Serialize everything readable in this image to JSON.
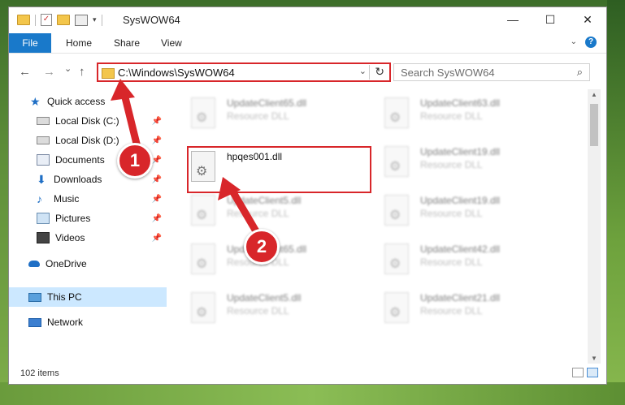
{
  "window": {
    "title": "SysWOW64",
    "controls": {
      "minimize": "—",
      "maximize": "☐",
      "close": "✕"
    }
  },
  "ribbon": {
    "file_tab": "File",
    "tabs": [
      "Home",
      "Share",
      "View"
    ]
  },
  "navigation": {
    "back_icon": "←",
    "forward_icon": "→",
    "recent_icon": "⌄",
    "up_icon": "↑",
    "address": "C:\\Windows\\SysWOW64",
    "refresh_icon": "↻",
    "search_placeholder": "Search SysWOW64",
    "search_icon": "⌕"
  },
  "sidebar": {
    "items": [
      {
        "label": "Quick access",
        "icon": "star-icon"
      },
      {
        "label": "Local Disk (C:)",
        "icon": "disk-icon",
        "pinned": true
      },
      {
        "label": "Local Disk (D:)",
        "icon": "disk-icon",
        "pinned": true
      },
      {
        "label": "Documents",
        "icon": "documents-icon",
        "pinned": true
      },
      {
        "label": "Downloads",
        "icon": "download-icon",
        "pinned": true
      },
      {
        "label": "Music",
        "icon": "music-icon",
        "pinned": true
      },
      {
        "label": "Pictures",
        "icon": "pictures-icon",
        "pinned": true
      },
      {
        "label": "Videos",
        "icon": "videos-icon",
        "pinned": true
      },
      {
        "label": "OneDrive",
        "icon": "onedrive-icon"
      },
      {
        "label": "This PC",
        "icon": "pc-icon",
        "selected": true
      },
      {
        "label": "Network",
        "icon": "network-icon"
      }
    ]
  },
  "files": [
    {
      "name": "UpdateClient65.dll",
      "type": "Resource DLL",
      "blurred": true
    },
    {
      "name": "UpdateClient63.dll",
      "type": "Resource DLL",
      "blurred": true
    },
    {
      "name": "hpqes001.dll",
      "type": "",
      "blurred": false,
      "highlighted": true
    },
    {
      "name": "UpdateClient19.dll",
      "type": "Resource DLL",
      "blurred": true
    },
    {
      "name": "UpdateClient5.dll",
      "type": "Resource DLL",
      "blurred": true
    },
    {
      "name": "UpdateClient19.dll",
      "type": "Resource DLL",
      "blurred": true
    },
    {
      "name": "UpdateClient65.dll",
      "type": "Resource DLL",
      "blurred": true
    },
    {
      "name": "UpdateClient42.dll",
      "type": "Resource DLL",
      "blurred": true
    },
    {
      "name": "UpdateClient5.dll",
      "type": "Resource DLL",
      "blurred": true
    },
    {
      "name": "UpdateClient21.dll",
      "type": "Resource DLL",
      "blurred": true
    }
  ],
  "status": {
    "item_count": "102 items"
  },
  "annotations": {
    "step1": "1",
    "step2": "2"
  },
  "colors": {
    "accent": "#1979ca",
    "highlight": "#d8262a",
    "selected": "#cce8ff"
  }
}
